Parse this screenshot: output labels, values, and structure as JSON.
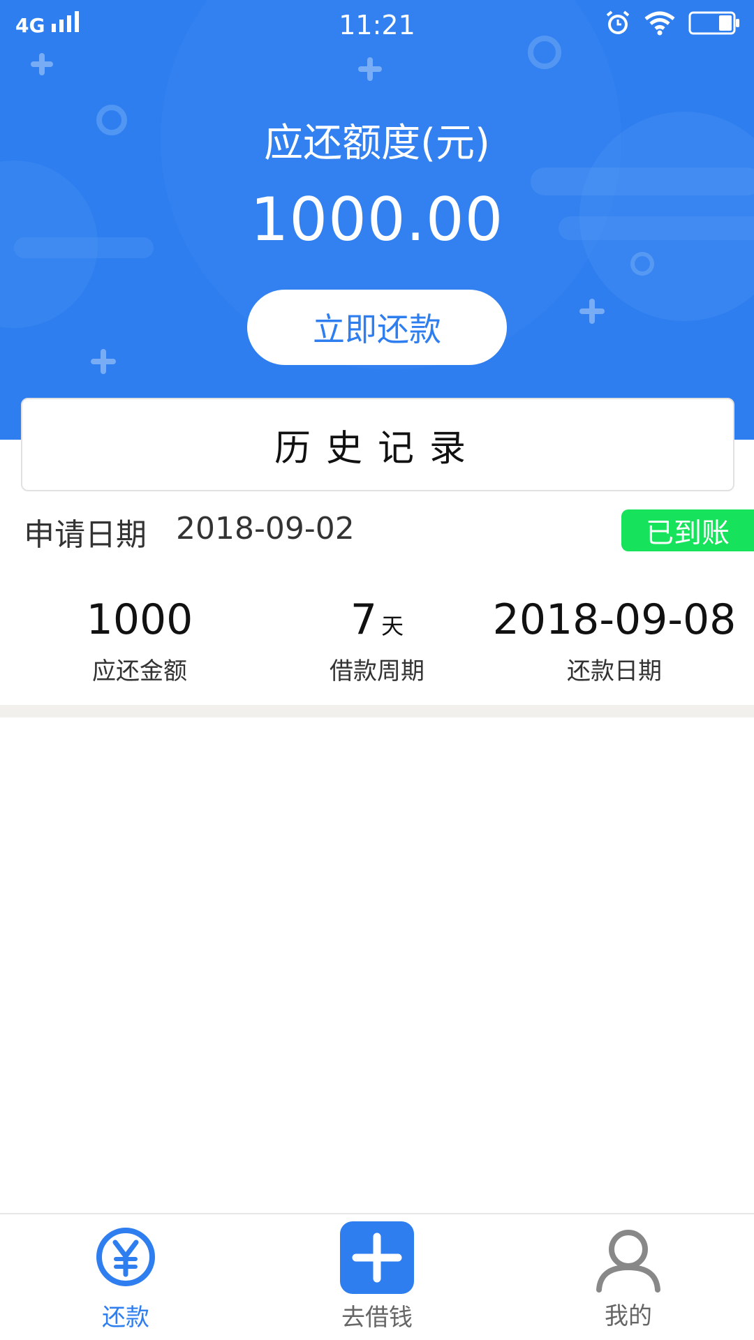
{
  "status_bar": {
    "network": "4G",
    "time": "11:21"
  },
  "hero": {
    "title": "应还额度(元)",
    "amount": "1000.00",
    "repay_button_label": "立即还款"
  },
  "history": {
    "title": "历史记录"
  },
  "record": {
    "date_label": "申请日期",
    "date_value": "2018-09-02",
    "status": "已到账",
    "stats": [
      {
        "value": "1000",
        "unit": "",
        "label": "应还金额"
      },
      {
        "value": "7",
        "unit": "天",
        "label": "借款周期"
      },
      {
        "value": "2018-09-08",
        "unit": "",
        "label": "还款日期"
      }
    ]
  },
  "tabbar": {
    "items": [
      {
        "label": "还款",
        "icon": "yuan-circle-icon",
        "active": true
      },
      {
        "label": "去借钱",
        "icon": "plus-square-icon",
        "active": false
      },
      {
        "label": "我的",
        "icon": "user-icon",
        "active": false
      }
    ]
  },
  "colors": {
    "primary": "#2e7ef0",
    "success": "#16e35b",
    "inactive": "#888888"
  }
}
